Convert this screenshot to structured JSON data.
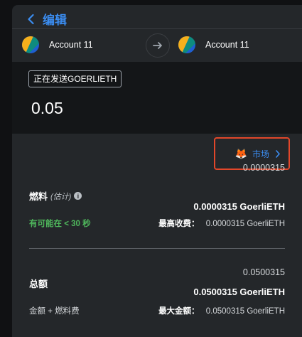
{
  "header": {
    "back_label": "编辑"
  },
  "accounts": {
    "from_name": "Account 11",
    "to_name": "Account 11"
  },
  "send": {
    "badge": "正在发送GOERLIETH",
    "amount": "0.05"
  },
  "market": {
    "label": "市场"
  },
  "gas": {
    "label": "燃料",
    "estimate_note": "(估计)",
    "amount_plain": "0.0000315",
    "amount_bold": "0.0000315 GoerliETH",
    "likely_text": "有可能在 < 30 秒",
    "max_fee_label": "最高收费：",
    "max_fee_value": "0.0000315 GoerliETH"
  },
  "total": {
    "label": "总额",
    "amount_plain": "0.0500315",
    "amount_bold": "0.0500315 GoerliETH",
    "subtitle": "金额 + 燃料费",
    "max_amount_label": "最大金额：",
    "max_amount_value": "0.0500315 GoerliETH"
  },
  "colors": {
    "accent_blue": "#3b8df1",
    "success_green": "#4fb75c",
    "highlight_red": "#e2472a",
    "panel_bg": "#24272a"
  }
}
